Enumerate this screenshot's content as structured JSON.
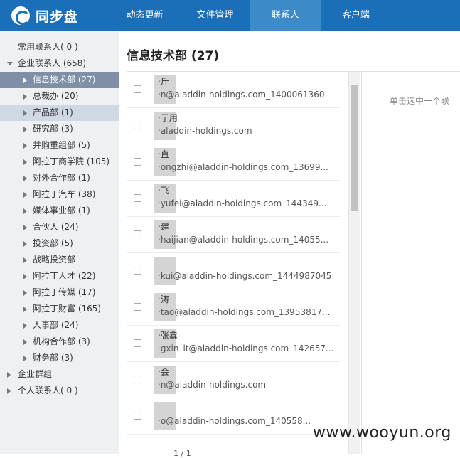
{
  "app": {
    "logo_text": "同步盘"
  },
  "nav": [
    {
      "label": "动态更新",
      "active": false
    },
    {
      "label": "文件管理",
      "active": false
    },
    {
      "label": "联系人",
      "active": true
    },
    {
      "label": "客户端",
      "active": false
    }
  ],
  "sidebar": {
    "frequent": "常用联系人( 0 )",
    "enterprise": "企业联系人 (658)",
    "departments": [
      {
        "label": "信息技术部 (27)",
        "state": "selected"
      },
      {
        "label": "总裁办 (20)",
        "state": ""
      },
      {
        "label": "产品部 (1)",
        "state": "hover"
      },
      {
        "label": "研究部 (3)",
        "state": ""
      },
      {
        "label": "并购重组部 (5)",
        "state": ""
      },
      {
        "label": "阿拉丁商学院 (105)",
        "state": ""
      },
      {
        "label": "对外合作部 (1)",
        "state": ""
      },
      {
        "label": "阿拉丁汽车 (38)",
        "state": ""
      },
      {
        "label": "媒体事业部 (1)",
        "state": ""
      },
      {
        "label": "合伙人 (24)",
        "state": ""
      },
      {
        "label": "投资部 (5)",
        "state": ""
      },
      {
        "label": "战略投资部",
        "state": ""
      },
      {
        "label": "阿拉丁人才 (22)",
        "state": ""
      },
      {
        "label": "阿拉丁传媒 (17)",
        "state": ""
      },
      {
        "label": "阿拉丁财富 (165)",
        "state": ""
      },
      {
        "label": "人事部 (24)",
        "state": ""
      },
      {
        "label": "机构合作部 (3)",
        "state": ""
      },
      {
        "label": "财务部 (3)",
        "state": ""
      }
    ],
    "groups": "企业群组",
    "personal": "个人联系人( 0 )"
  },
  "main": {
    "title": "信息技术部 (27)",
    "detail_hint": "单击选中一个联",
    "pager": "1 / 1",
    "contacts": [
      {
        "name": "‧斤",
        "email": "‧n@aladdin-holdings.com_1400061360"
      },
      {
        "name": "‧亍用",
        "email": "‧aladdin-holdings.com"
      },
      {
        "name": "‧直",
        "email": "‧ongzhi@aladdin-holdings.com_13699..."
      },
      {
        "name": "‧飞",
        "email": "‧yufei@aladdin-holdings.com_144349..."
      },
      {
        "name": "‧建",
        "email": "‧haijian@aladdin-holdings.com_14055..."
      },
      {
        "name": "",
        "email": "‧kui@aladdin-holdings.com_1444987045"
      },
      {
        "name": "‧涛",
        "email": "‧tao@aladdin-holdings.com_13953817..."
      },
      {
        "name": "‧张鑫",
        "email": "‧gxin_it@aladdin-holdings.com_142657..."
      },
      {
        "name": "‧会",
        "email": "‧n@aladdin-holdings.com"
      },
      {
        "name": "",
        "email": "‧o@aladdin-holdings.com_140558..."
      }
    ]
  },
  "watermark": "www.wooyun.org"
}
